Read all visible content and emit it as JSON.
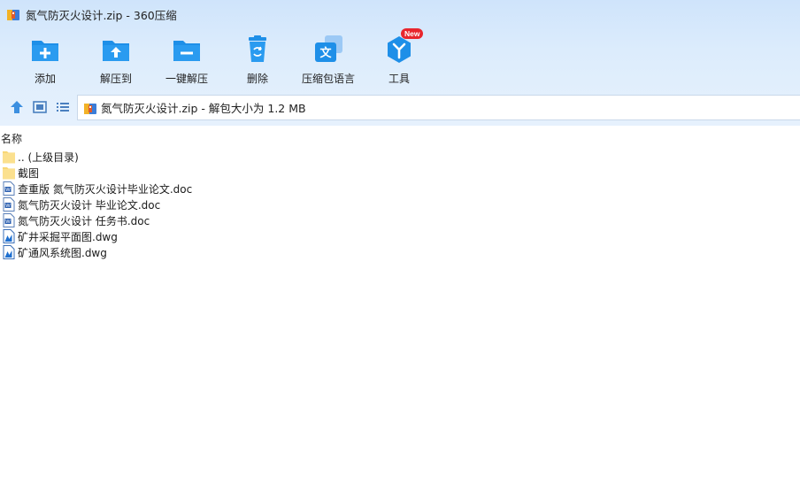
{
  "window": {
    "title": "氮气防灭火设计.zip - 360压缩"
  },
  "toolbar": {
    "items": [
      {
        "label": "添加",
        "icon": "add-icon"
      },
      {
        "label": "解压到",
        "icon": "extract-to-icon"
      },
      {
        "label": "一键解压",
        "icon": "one-click-extract-icon"
      },
      {
        "label": "删除",
        "icon": "delete-icon"
      },
      {
        "label": "压缩包语言",
        "icon": "archive-language-icon"
      },
      {
        "label": "工具",
        "icon": "tools-icon",
        "badge": "New"
      }
    ]
  },
  "address": {
    "text": "氮气防灭火设计.zip - 解包大小为 1.2 MB"
  },
  "columns": {
    "name": "名称"
  },
  "files": [
    {
      "name": ".. (上级目录)",
      "type": "folder"
    },
    {
      "name": "截图",
      "type": "folder"
    },
    {
      "name": "查重版 氮气防灭火设计毕业论文.doc",
      "type": "doc"
    },
    {
      "name": "氮气防灭火设计 毕业论文.doc",
      "type": "doc"
    },
    {
      "name": "氮气防灭火设计 任务书.doc",
      "type": "doc"
    },
    {
      "name": "矿井采掘平面图.dwg",
      "type": "dwg"
    },
    {
      "name": "矿通风系统图.dwg",
      "type": "dwg"
    }
  ],
  "colors": {
    "accent": "#1e8fe8",
    "badge": "#e8262d",
    "folder": "#f8d775"
  }
}
